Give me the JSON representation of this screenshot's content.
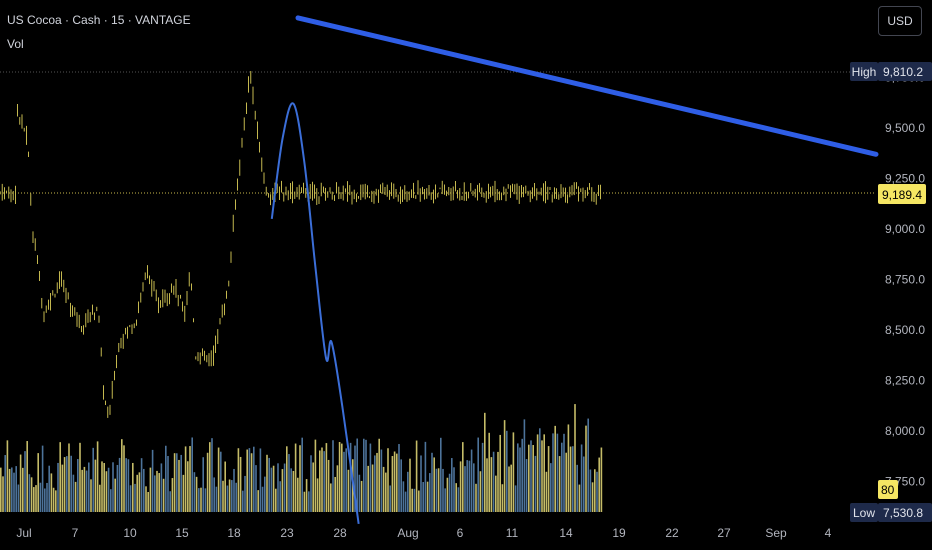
{
  "header": {
    "symbol_line": "US Cocoa · Cash · 15 · VANTAGE",
    "indicator": "Vol",
    "currency_button": "USD"
  },
  "badges": {
    "high_label": "High",
    "high_value": "9,810.2",
    "current_value": "9,189.4",
    "low_label": "Low",
    "low_value": "7,530.8",
    "volume_value": "80"
  },
  "colors": {
    "background": "#000000",
    "candle": "#f5e663",
    "volume_a": "#e7dd7a",
    "volume_b": "#5a87b5",
    "trendline": "#2f5ee6",
    "projection": "#3b6ed8",
    "current_badge": "#f5e663",
    "high_badge": "#1e2a4a"
  },
  "chart_data": {
    "type": "line",
    "y_axis": {
      "ticks": [
        "9,750.0",
        "9,500.0",
        "9,250.0",
        "9,000.0",
        "8,750.0",
        "8,500.0",
        "8,250.0",
        "8,000.0",
        "7,750.0"
      ],
      "tick_values": [
        9750,
        9500,
        9250,
        9000,
        8750,
        8500,
        8250,
        8000,
        7750
      ],
      "range": [
        7530.8,
        9810.2
      ]
    },
    "x_axis": {
      "ticks": [
        "Jul",
        "7",
        "10",
        "15",
        "18",
        "23",
        "28",
        "Aug",
        "6",
        "11",
        "14",
        "19",
        "22",
        "27",
        "Sep",
        "4"
      ]
    },
    "price_series": {
      "name": "",
      "x": [
        "Jun 30",
        "Jul 2",
        "Jul 3",
        "Jul 4",
        "Jul 5",
        "Jul 8",
        "Jul 10",
        "Jul 12",
        "Jul 15",
        "Jul 16",
        "Jul 17",
        "Jul 18",
        "Jul 19",
        "Jul 22",
        "Jul 24",
        "Jul 26",
        "Jul 29",
        "Jul 31",
        "Aug 1",
        "Aug 2",
        "Aug 5",
        "Aug 7",
        "Aug 8",
        "Aug 9",
        "Aug 12",
        "Aug 13",
        "Aug 14",
        "Aug 15"
      ],
      "values": [
        9600,
        9450,
        8980,
        8820,
        8580,
        8750,
        8620,
        8520,
        8620,
        8200,
        8050,
        8280,
        8450,
        8550,
        8800,
        8620,
        8720,
        8580,
        8800,
        8380,
        8350,
        8600,
        8700,
        9050,
        9780,
        9550,
        9350,
        9180
      ]
    },
    "projection_series": {
      "name": "",
      "x": [
        "Aug 16",
        "Aug 18",
        "Aug 20",
        "Aug 22",
        "Aug 24",
        "Aug 26",
        "Aug 27",
        "Aug 29",
        "Sep 1"
      ],
      "values": [
        9050,
        9450,
        9620,
        9330,
        8820,
        8360,
        8440,
        8120,
        7540
      ]
    },
    "trendline": {
      "x": [
        "Jul 18",
        "Sep 6"
      ],
      "values": [
        10045,
        9370
      ]
    },
    "high": 9810.2,
    "low": 7530.8,
    "current": 9189.4,
    "volume_last": 80
  }
}
